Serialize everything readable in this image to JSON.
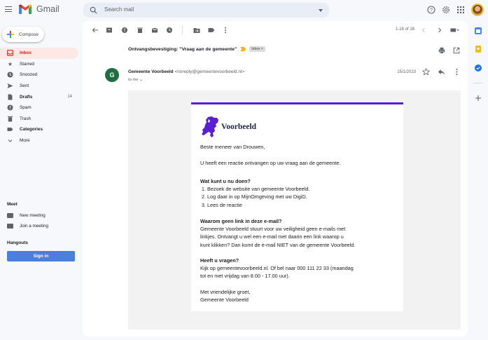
{
  "app": {
    "name": "Gmail",
    "search_placeholder": "Search mail"
  },
  "colors": {
    "accent_red": "#d93025",
    "brand_purple": "#5a1fd3",
    "signin_blue": "#4a7fe0",
    "sender_avatar": "#1e6f3f"
  },
  "sidebar": {
    "compose_label": "Compose",
    "items": [
      {
        "label": "Inbox",
        "icon": "inbox-icon",
        "count": ""
      },
      {
        "label": "Starred",
        "icon": "star-icon",
        "count": ""
      },
      {
        "label": "Snoozed",
        "icon": "clock-icon",
        "count": ""
      },
      {
        "label": "Sent",
        "icon": "send-icon",
        "count": ""
      },
      {
        "label": "Drafts",
        "icon": "draft-icon",
        "count": "14"
      },
      {
        "label": "Spam",
        "icon": "spam-icon",
        "count": ""
      },
      {
        "label": "Trash",
        "icon": "trash-icon",
        "count": ""
      },
      {
        "label": "Categories",
        "icon": "label-icon",
        "count": ""
      },
      {
        "label": "More",
        "icon": "chevron-down-icon",
        "count": ""
      }
    ],
    "meet": {
      "heading": "Meet",
      "new_meeting": "New meeting",
      "join_meeting": "Join a meeting"
    },
    "hangouts": {
      "heading": "Hangouts",
      "sign_in": "Sign in"
    }
  },
  "toolbar": {
    "pager": "1-16 of 16"
  },
  "email": {
    "subject": "Ontvangsbevestiging: \"Vraag aan de gemeente\"",
    "label_chip": "Inbox ×",
    "sender_initial": "G",
    "sender_name": "Gemeente Voorbeeld",
    "sender_email": "<noreply@gemeentevoorbeeld.nl>",
    "to_line": "to me ⌄",
    "date": "15/1/2023",
    "body": {
      "brand_name": "Voorbeeld",
      "greeting": "Beste meneer van Drouwen,",
      "intro": "U heeft een reactie ontvangen op uw vraag aan de gemeente.",
      "section1_heading": "Wat kunt u nu doen?",
      "steps": [
        "Bezoek de website van gemeente Voorbeeld.",
        "Log daar in op MijnOmgeving met uw DigiD.",
        "Lees de reactie"
      ],
      "section2_heading": "Waarom geen link in deze e-mail?",
      "section2_lines": [
        "Gemeente Voorbeeld stuurt voor uw veiligheid geen e-mails met",
        "linkjes. Ontvangt u wel een e-mail met daarin een link waarop u",
        "kunt klikken? Dan komt de e-mail NIET van de gemeente Voorbeeld."
      ],
      "section3_heading": "Heeft u vragen?",
      "section3_lines": [
        "Kijk op gemeentevoorbeeld.nl. Of bel naar 000 111 22 33 (maandag",
        "tot en met vrijdag van 8.00 - 17.00 uur)."
      ],
      "closing": "Met vriendelijke groet,",
      "signature": "Gemeente Voorbeeld"
    }
  }
}
